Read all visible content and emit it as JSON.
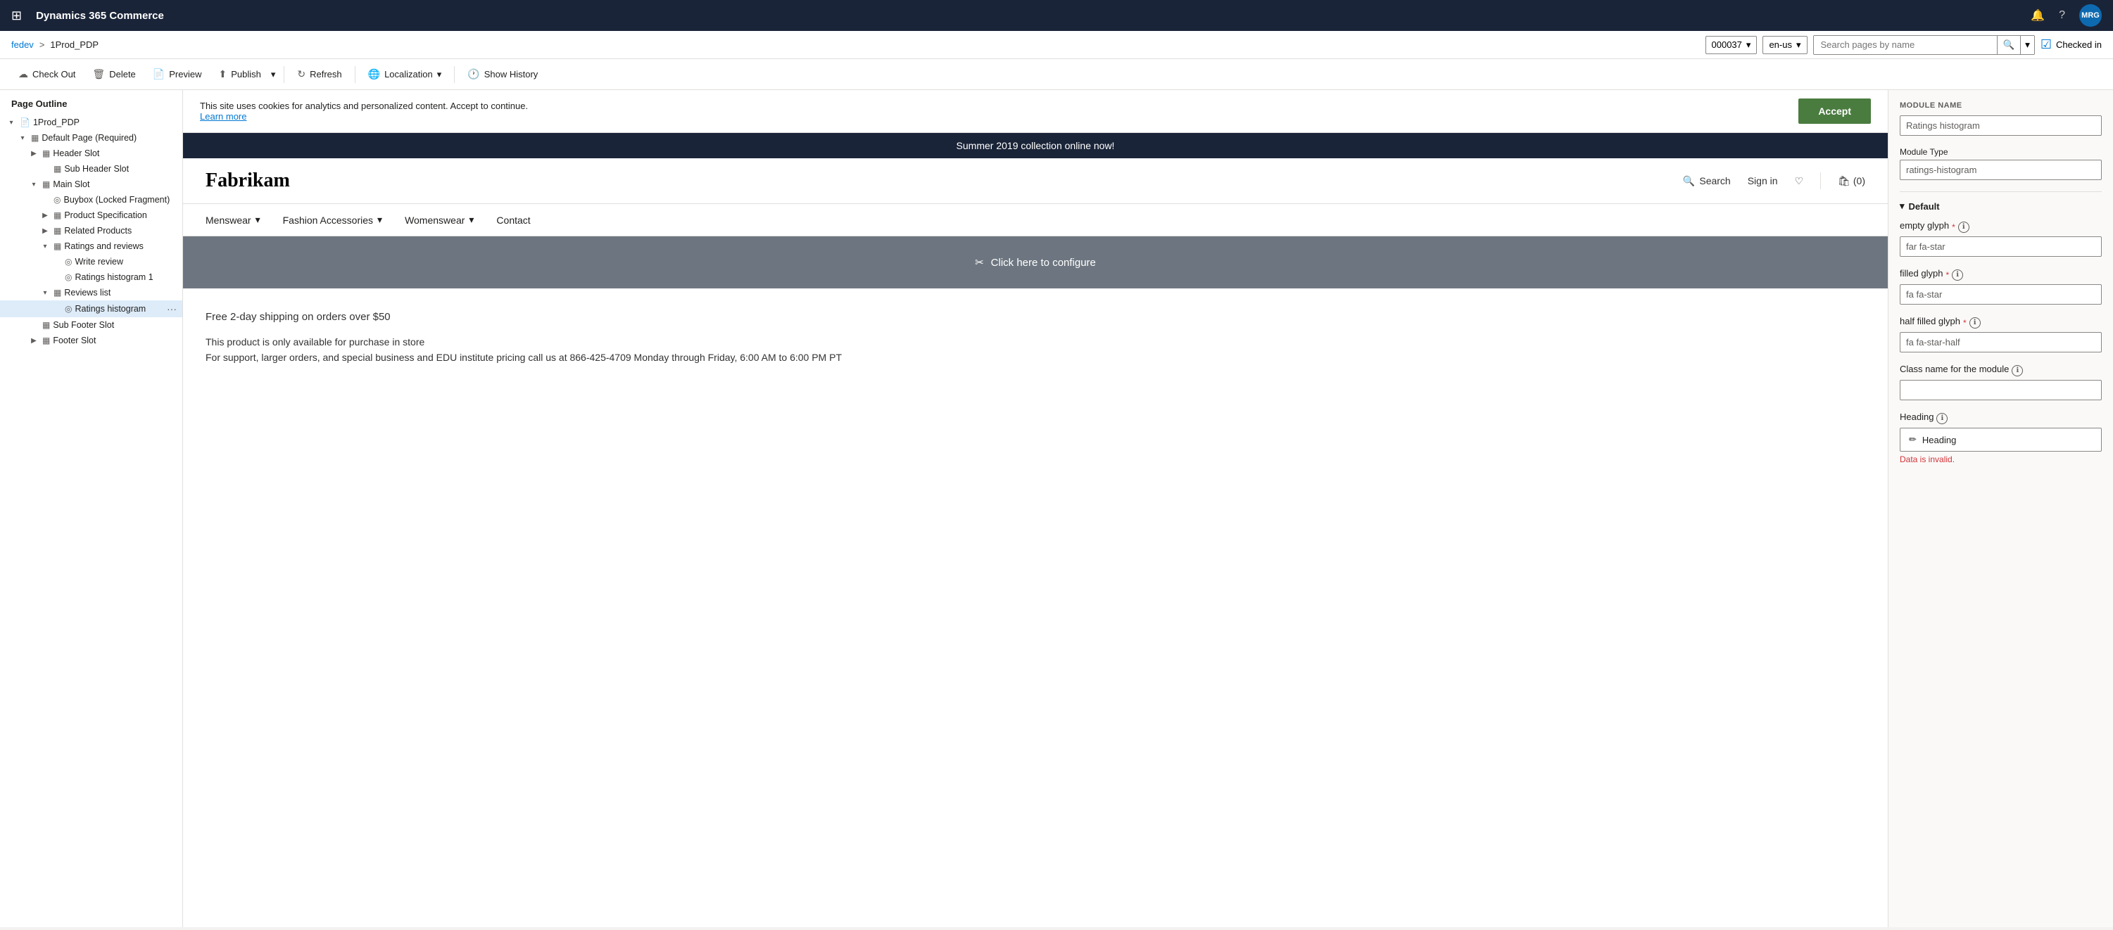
{
  "topNav": {
    "gridIcon": "⊞",
    "appTitle": "Dynamics 365 Commerce",
    "bellIcon": "🔔",
    "helpIcon": "?",
    "avatarLabel": "MRG"
  },
  "breadcrumb": {
    "link": "fedev",
    "separator": ">",
    "current": "1Prod_PDP"
  },
  "dropdowns": {
    "storeId": "000037",
    "locale": "en-us"
  },
  "searchPages": {
    "placeholder": "Search pages by name"
  },
  "toolbar": {
    "checkoutLabel": "Check Out",
    "deleteLabel": "Delete",
    "previewLabel": "Preview",
    "publishLabel": "Publish",
    "refreshLabel": "Refresh",
    "localizationLabel": "Localization",
    "showHistoryLabel": "Show History",
    "checkedInLabel": "Checked in"
  },
  "pageOutline": {
    "header": "Page Outline",
    "nodes": [
      {
        "id": "root",
        "label": "1Prod_PDP",
        "indent": 0,
        "toggle": "▾",
        "icon": "📄",
        "selected": false
      },
      {
        "id": "default-page",
        "label": "Default Page (Required)",
        "indent": 1,
        "toggle": "▾",
        "icon": "▦",
        "selected": false
      },
      {
        "id": "header-slot",
        "label": "Header Slot",
        "indent": 2,
        "toggle": "▶",
        "icon": "▦",
        "selected": false
      },
      {
        "id": "sub-header-slot",
        "label": "Sub Header Slot",
        "indent": 3,
        "toggle": "",
        "icon": "▦",
        "selected": false
      },
      {
        "id": "main-slot",
        "label": "Main Slot",
        "indent": 2,
        "toggle": "▾",
        "icon": "▦",
        "selected": false
      },
      {
        "id": "buybox",
        "label": "Buybox (Locked Fragment)",
        "indent": 3,
        "toggle": "",
        "icon": "◎",
        "selected": false
      },
      {
        "id": "product-spec",
        "label": "Product Specification",
        "indent": 3,
        "toggle": "▶",
        "icon": "▦",
        "selected": false
      },
      {
        "id": "related-products",
        "label": "Related Products",
        "indent": 3,
        "toggle": "▶",
        "icon": "▦",
        "selected": false
      },
      {
        "id": "ratings-reviews",
        "label": "Ratings and reviews",
        "indent": 3,
        "toggle": "▾",
        "icon": "▦",
        "selected": false
      },
      {
        "id": "write-review",
        "label": "Write review",
        "indent": 4,
        "toggle": "",
        "icon": "◎",
        "selected": false
      },
      {
        "id": "ratings-histogram-1",
        "label": "Ratings histogram 1",
        "indent": 4,
        "toggle": "",
        "icon": "◎",
        "selected": false
      },
      {
        "id": "reviews-list",
        "label": "Reviews list",
        "indent": 3,
        "toggle": "▾",
        "icon": "▦",
        "selected": false
      },
      {
        "id": "ratings-histogram",
        "label": "Ratings histogram",
        "indent": 4,
        "toggle": "",
        "icon": "◎",
        "selected": true
      },
      {
        "id": "sub-footer-slot",
        "label": "Sub Footer Slot",
        "indent": 2,
        "toggle": "",
        "icon": "▦",
        "selected": false
      },
      {
        "id": "footer-slot",
        "label": "Footer Slot",
        "indent": 2,
        "toggle": "▶",
        "icon": "▦",
        "selected": false
      }
    ]
  },
  "preview": {
    "cookieBanner": {
      "text": "This site uses cookies for analytics and personalized content. Accept to continue.",
      "learnMore": "Learn more",
      "acceptLabel": "Accept"
    },
    "promoBanner": "Summer 2019 collection online now!",
    "siteLogo": "Fabrikam",
    "navSearch": "Search",
    "navSignIn": "Sign in",
    "navCart": "(0)",
    "navItems": [
      {
        "label": "Menswear",
        "hasDropdown": true
      },
      {
        "label": "Fashion Accessories",
        "hasDropdown": true
      },
      {
        "label": "Womenswear",
        "hasDropdown": true
      },
      {
        "label": "Contact",
        "hasDropdown": false
      }
    ],
    "configureText": "Click here to configure",
    "configureIcon": "✂",
    "shippingText": "Free 2-day shipping on orders over $50",
    "productDesc": "This product is only available for purchase in store\nFor support, larger orders, and special business and EDU institute pricing call us at 866-425-4709 Monday through Friday, 6:00 AM to 6:00 PM PT"
  },
  "rightPanel": {
    "moduleName": {
      "sectionTitle": "MODULE NAME",
      "value": "Ratings histogram"
    },
    "moduleType": {
      "label": "Module Type",
      "value": "ratings-histogram"
    },
    "defaultSection": "Default",
    "fields": {
      "emptyGlyph": {
        "label": "empty glyph",
        "required": true,
        "value": "far fa-star"
      },
      "filledGlyph": {
        "label": "filled glyph",
        "required": true,
        "value": "fa fa-star"
      },
      "halfFilledGlyph": {
        "label": "half filled glyph",
        "required": true,
        "value": "fa fa-star-half"
      },
      "classNameForModule": {
        "label": "Class name for the module",
        "required": false,
        "value": ""
      },
      "heading": {
        "label": "Heading",
        "required": false,
        "btnLabel": "Heading",
        "editIcon": "✏",
        "errorText": "Data is invalid."
      }
    }
  }
}
